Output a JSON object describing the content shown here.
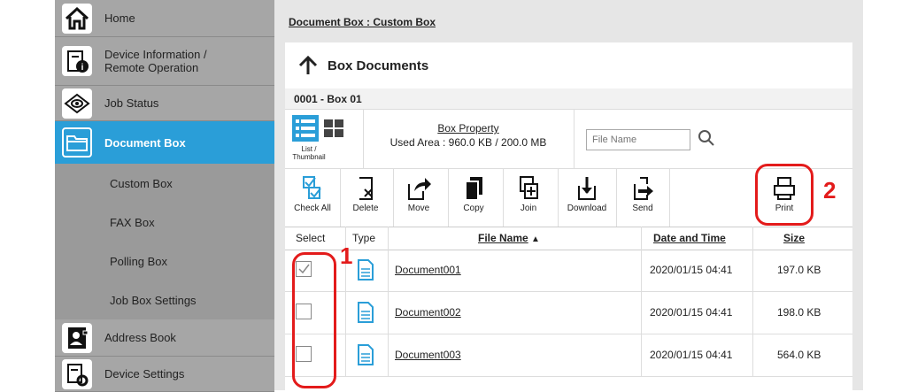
{
  "sidebar": {
    "items": [
      {
        "label": "Home",
        "icon": "home-icon"
      },
      {
        "label": "Device Information /\nRemote Operation",
        "icon": "device-info-icon"
      },
      {
        "label": "Job Status",
        "icon": "eye-icon"
      },
      {
        "label": "Document Box",
        "icon": "folder-icon"
      },
      {
        "label": "Custom Box"
      },
      {
        "label": "FAX Box"
      },
      {
        "label": "Polling Box"
      },
      {
        "label": "Job Box Settings"
      },
      {
        "label": "Address Book",
        "icon": "address-book-icon"
      },
      {
        "label": "Device Settings",
        "icon": "device-settings-icon"
      }
    ],
    "active_color": "#2a9ed8"
  },
  "breadcrumb": "Document Box : Custom Box",
  "panel": {
    "title": "Box Documents",
    "box_name": "0001 - Box 01",
    "view_label": "List /\nThumbnail",
    "box_property_link": "Box Property",
    "used_area": "Used Area : 960.0 KB / 200.0 MB",
    "search_placeholder": "File Name"
  },
  "toolbar": [
    {
      "label": "Check All",
      "icon": "check-all-icon"
    },
    {
      "label": "Delete",
      "icon": "delete-icon"
    },
    {
      "label": "Move",
      "icon": "move-icon"
    },
    {
      "label": "Copy",
      "icon": "copy-icon"
    },
    {
      "label": "Join",
      "icon": "join-icon"
    },
    {
      "label": "Download",
      "icon": "download-icon"
    },
    {
      "label": "Send",
      "icon": "send-icon"
    },
    {
      "label": "Print",
      "icon": "print-icon"
    }
  ],
  "table": {
    "headers": {
      "select": "Select",
      "type": "Type",
      "file_name": "File Name",
      "sort_indicator": "▲",
      "date": "Date and Time",
      "size": "Size"
    },
    "rows": [
      {
        "name": "Document001",
        "date": "2020/01/15 04:41",
        "size": "197.0 KB",
        "checked": true
      },
      {
        "name": "Document002",
        "date": "2020/01/15 04:41",
        "size": "198.0 KB",
        "checked": false
      },
      {
        "name": "Document003",
        "date": "2020/01/15 04:41",
        "size": "564.0 KB",
        "checked": false
      }
    ]
  },
  "callouts": {
    "one": "1",
    "two": "2",
    "color": "#e31b1b"
  }
}
